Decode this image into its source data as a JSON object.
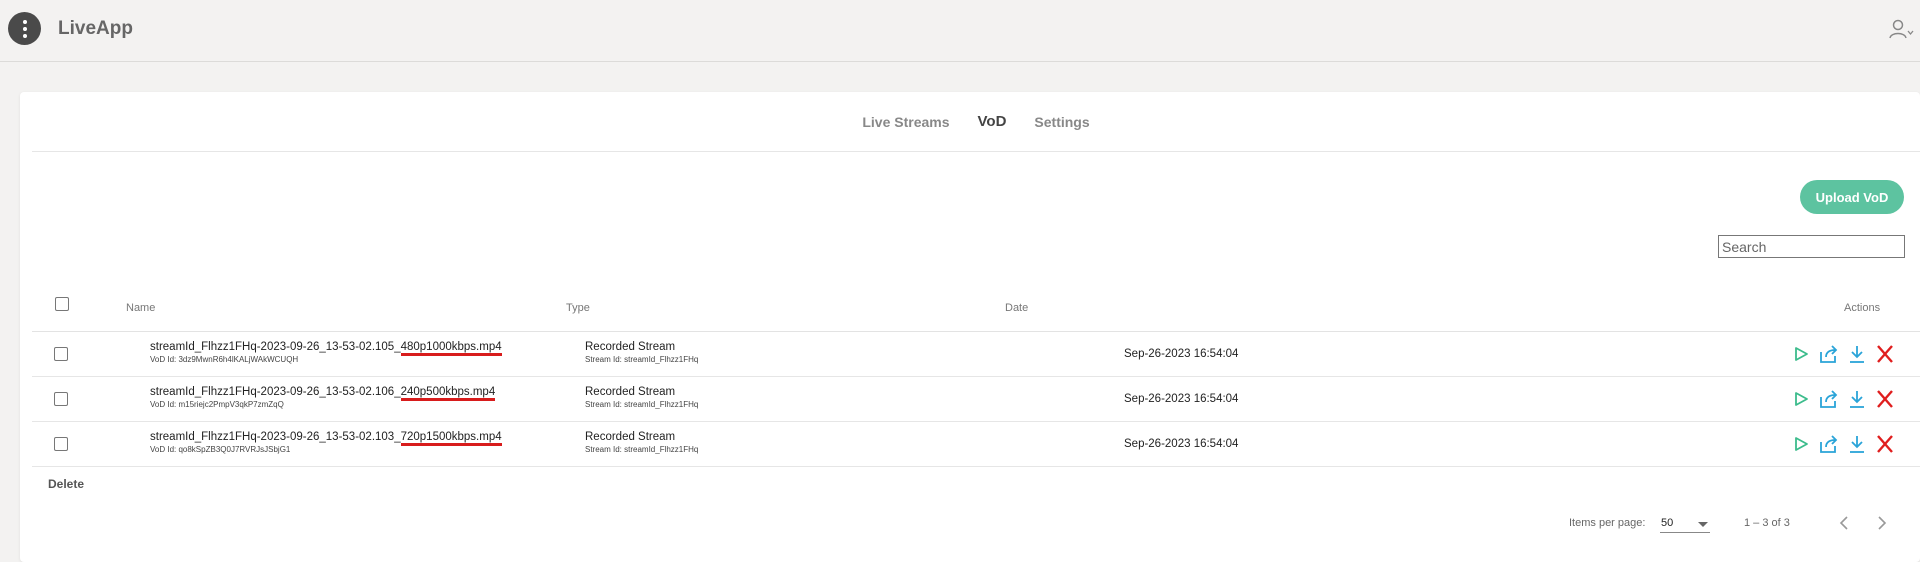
{
  "app": {
    "title": "LiveApp"
  },
  "tabs": [
    {
      "label": "Live Streams",
      "active": false
    },
    {
      "label": "VoD",
      "active": true
    },
    {
      "label": "Settings",
      "active": false
    }
  ],
  "toolbar": {
    "upload_label": "Upload VoD",
    "search_placeholder": "Search",
    "search_value": ""
  },
  "table": {
    "columns": {
      "name": "Name",
      "type": "Type",
      "date": "Date",
      "actions": "Actions"
    },
    "rows": [
      {
        "name_base": "streamId_Flhzz1FHq-2023-09-26_13-53-02.105_",
        "name_res": "480p1000kbps.mp4",
        "vod_id": "VoD Id: 3dz9MwnR6h4lKALjWAkWCUQH",
        "type": "Recorded Stream",
        "stream_id": "Stream Id: streamId_Flhzz1FHq",
        "date": "Sep-26-2023 16:54:04"
      },
      {
        "name_base": "streamId_Flhzz1FHq-2023-09-26_13-53-02.106_",
        "name_res": "240p500kbps.mp4",
        "vod_id": "VoD Id: m15riejc2PmpV3qkP7zmZqQ",
        "type": "Recorded Stream",
        "stream_id": "Stream Id: streamId_Flhzz1FHq",
        "date": "Sep-26-2023 16:54:04"
      },
      {
        "name_base": "streamId_Flhzz1FHq-2023-09-26_13-53-02.103_",
        "name_res": "720p1500kbps.mp4",
        "vod_id": "VoD Id: qo8kSpZB3Q0J7RVRJsJSbjG1",
        "type": "Recorded Stream",
        "stream_id": "Stream Id: streamId_Flhzz1FHq",
        "date": "Sep-26-2023 16:54:04"
      }
    ]
  },
  "footer": {
    "delete_label": "Delete"
  },
  "paginator": {
    "items_per_page_label": "Items per page:",
    "items_per_page": "50",
    "range": "1 – 3 of 3"
  },
  "icons": [
    "menu-icon",
    "user-icon",
    "play-icon",
    "share-icon",
    "download-icon",
    "delete-icon",
    "chevron-left-icon",
    "chevron-right-icon"
  ],
  "colors": {
    "accent": "#5dc3a0",
    "action_icon": "#2aa4d8",
    "play_icon": "#3cbc8c",
    "danger": "#e01e1e",
    "highlight_underline": "#d81c1c"
  }
}
